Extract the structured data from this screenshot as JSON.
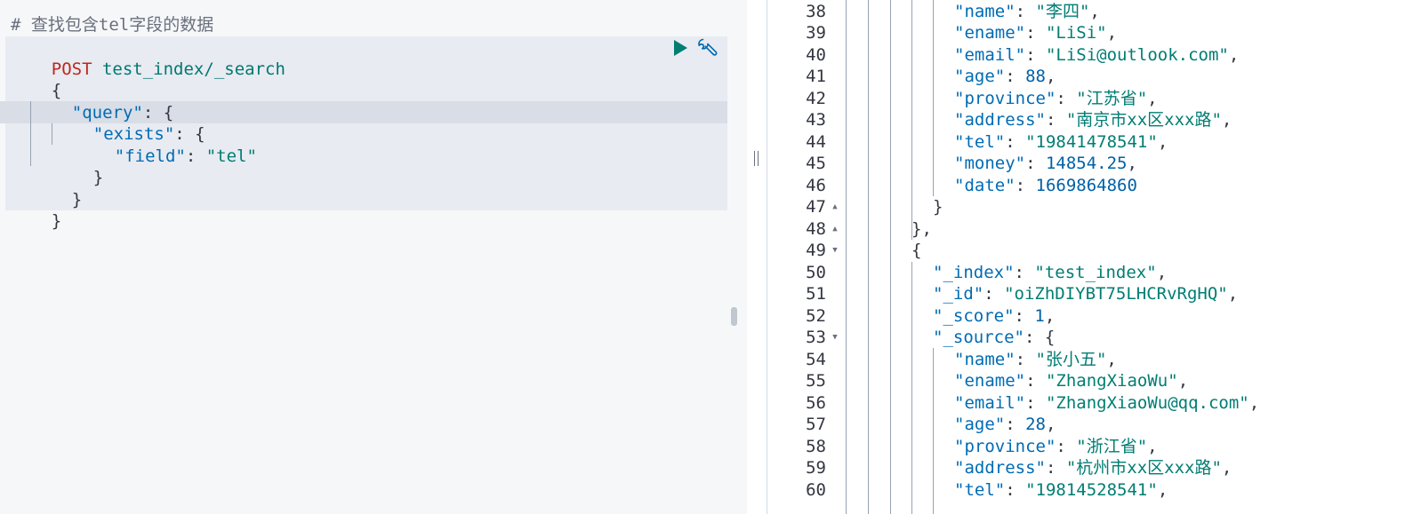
{
  "request": {
    "comment": "# 查找包含tel字段的数据",
    "method": "POST",
    "url": "test_index/_search",
    "lines": [
      "{",
      "\"query\": {",
      "\"exists\": {",
      "\"field\": \"tel\"",
      "}",
      "}",
      "}"
    ],
    "tokens": {
      "open_brace": "{",
      "query_key": "\"query\"",
      "exists_key": "\"exists\"",
      "field_key": "\"field\"",
      "tel_value": "\"tel\"",
      "colon_brace": ": {",
      "colon": ": ",
      "close_brace": "}"
    },
    "run_icon": "play-icon",
    "settings_icon": "wrench-icon"
  },
  "response": {
    "lines": [
      {
        "num": "38",
        "key": "\"name\"",
        "value": "\"李四\"",
        "tail": ","
      },
      {
        "num": "39",
        "key": "\"ename\"",
        "value": "\"LiSi\"",
        "tail": ","
      },
      {
        "num": "40",
        "key": "\"email\"",
        "value": "\"LiSi@outlook.com\"",
        "tail": ","
      },
      {
        "num": "41",
        "key": "\"age\"",
        "value": "88",
        "tail": ","
      },
      {
        "num": "42",
        "key": "\"province\"",
        "value": "\"江苏省\"",
        "tail": ","
      },
      {
        "num": "43",
        "key": "\"address\"",
        "value": "\"南京市xx区xxx路\"",
        "tail": ","
      },
      {
        "num": "44",
        "key": "\"tel\"",
        "value": "\"19841478541\"",
        "tail": ","
      },
      {
        "num": "45",
        "key": "\"money\"",
        "value": "14854.25",
        "tail": ","
      },
      {
        "num": "46",
        "key": "\"date\"",
        "value": "1669864860",
        "tail": ""
      },
      {
        "num": "47",
        "text": "}"
      },
      {
        "num": "48",
        "text": "},"
      },
      {
        "num": "49",
        "text": "{"
      },
      {
        "num": "50",
        "key": "\"_index\"",
        "value": "\"test_index\"",
        "tail": ","
      },
      {
        "num": "51",
        "key": "\"_id\"",
        "value": "\"oiZhDIYBT75LHCRvRgHQ\"",
        "tail": ","
      },
      {
        "num": "52",
        "key": "\"_score\"",
        "value": "1",
        "tail": ","
      },
      {
        "num": "53",
        "key": "\"_source\"",
        "value": "{",
        "tail": ""
      },
      {
        "num": "54",
        "key": "\"name\"",
        "value": "\"张小五\"",
        "tail": ","
      },
      {
        "num": "55",
        "key": "\"ename\"",
        "value": "\"ZhangXiaoWu\"",
        "tail": ","
      },
      {
        "num": "56",
        "key": "\"email\"",
        "value": "\"ZhangXiaoWu@qq.com\"",
        "tail": ","
      },
      {
        "num": "57",
        "key": "\"age\"",
        "value": "28",
        "tail": ","
      },
      {
        "num": "58",
        "key": "\"province\"",
        "value": "\"浙江省\"",
        "tail": ","
      },
      {
        "num": "59",
        "key": "\"address\"",
        "value": "\"杭州市xx区xxx路\"",
        "tail": ","
      },
      {
        "num": "60",
        "key": "\"tel\"",
        "value": "\"19814528541\"",
        "tail": ","
      }
    ],
    "fold_markers": {
      "47": "▲",
      "48": "▲",
      "49": "▼",
      "53": "▼"
    },
    "colon": ": "
  },
  "colors": {
    "method": "#bd271e",
    "key": "#006bb4",
    "string": "#017d73",
    "comment": "#69707d",
    "run_button": "#017d73",
    "wrench": "#006bb4"
  }
}
